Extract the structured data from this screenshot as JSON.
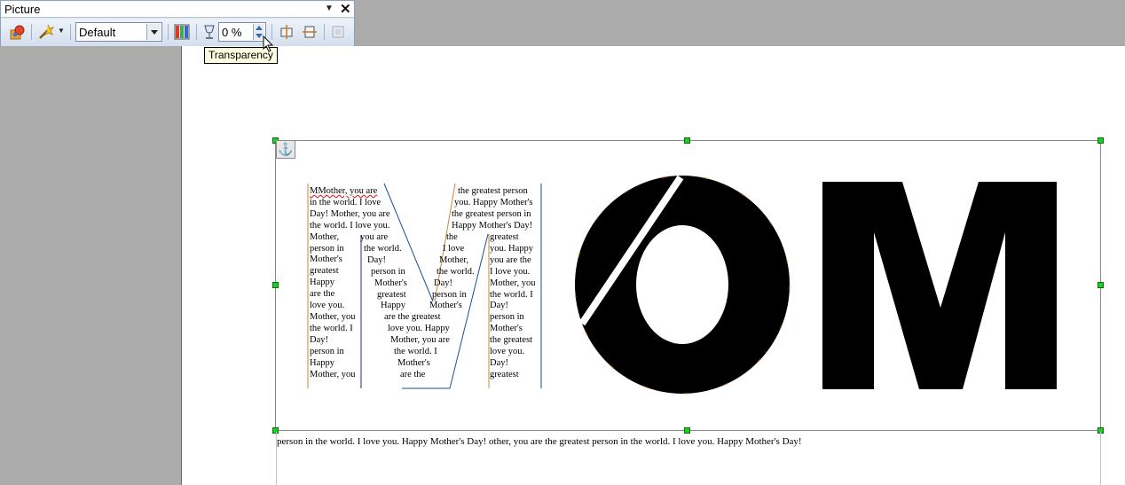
{
  "toolbar": {
    "title": "Picture",
    "color_mode": "Default",
    "transparency": "0 %",
    "tooltip": "Transparency"
  },
  "document": {
    "wordart_letters": [
      "M",
      "O",
      "M"
    ],
    "m_left_lines": [
      "MMother, you are",
      "in the world. I love",
      "Day! Mother, you are",
      "the world. I love you.",
      "Mother,",
      "person in",
      "Mother's",
      "greatest",
      "Happy",
      "are the",
      "love you.",
      "Mother, you",
      "the world. I",
      "Day!",
      "person in",
      "Happy",
      "Mother, you"
    ],
    "m_diag1_lines": [
      "you are",
      "the world.",
      "Day!",
      "person in",
      "Mother's",
      "greatest",
      "Happy",
      "are the greatest",
      "love you. Happy",
      "Mother, you are",
      "the world. I",
      "Mother's",
      "are the"
    ],
    "m_right_top_lines": [
      "the greatest person",
      "you. Happy Mother's",
      "the greatest person in",
      "Happy Mother's Day!"
    ],
    "m_diag2_lines": [
      "the",
      "I love",
      "Mother,",
      "the world.",
      "Day!",
      "person in",
      "Mother's"
    ],
    "m_right_lines": [
      "greatest",
      "you. Happy",
      "you are the",
      "I love you.",
      "Mother, you",
      "the world. I",
      "Day!",
      "person in",
      "Mother's",
      "the greatest",
      "love you.",
      "Day!",
      "greatest"
    ],
    "caption": "person in the world. I love you. Happy Mother's Day! other, you are the greatest person in the world. I love you. Happy Mother's Day!"
  },
  "colors": {
    "accent_green": "#1fcf1f",
    "letter_fill": "#000000"
  }
}
